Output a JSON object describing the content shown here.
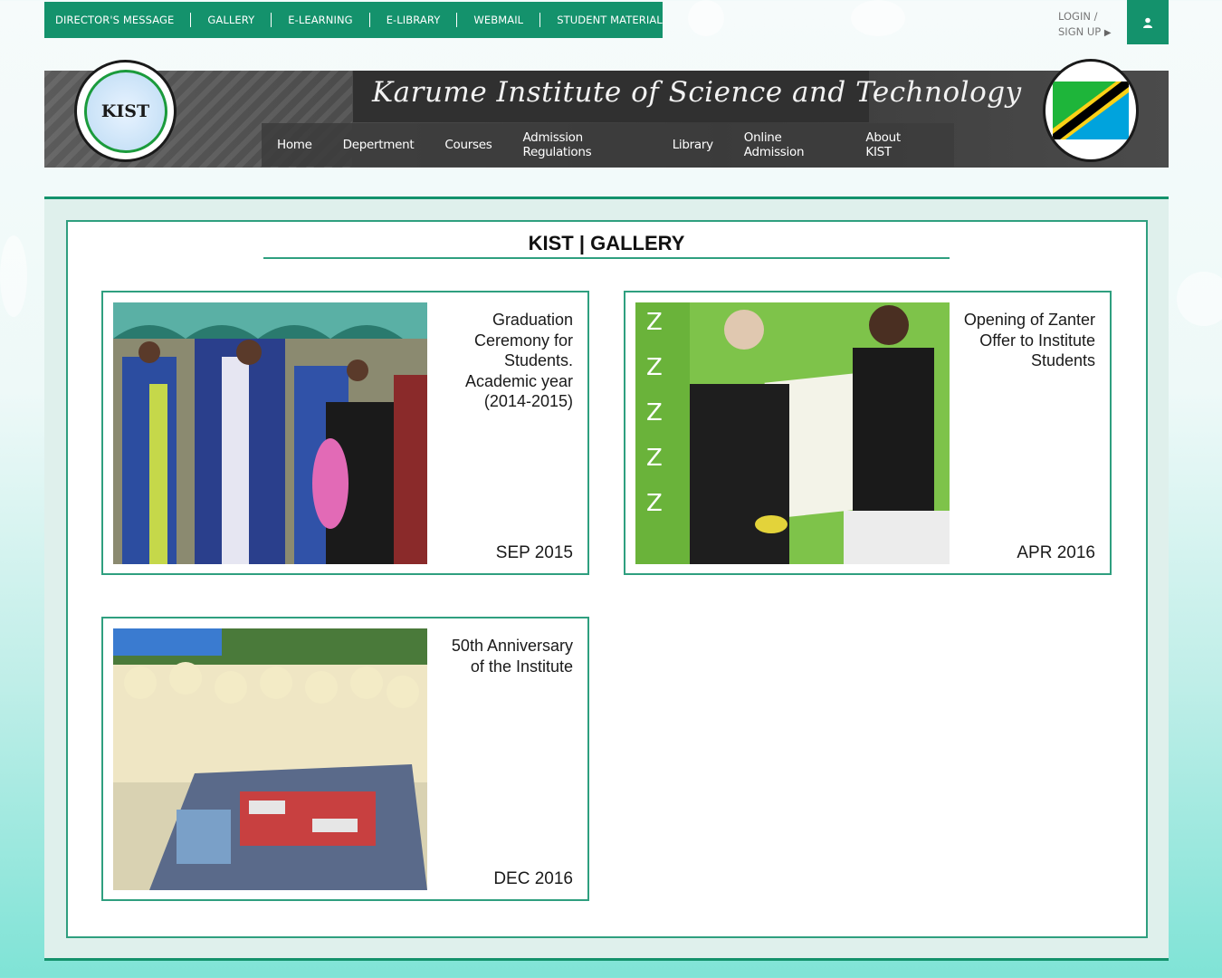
{
  "top_nav": {
    "items": [
      "DIRECTOR'S MESSAGE",
      "GALLERY",
      "E-LEARNING",
      "E-LIBRARY",
      "WEBMAIL",
      "STUDENT MATERIAL"
    ]
  },
  "account": {
    "login_label": "LOGIN /",
    "signup_label": "SIGN UP",
    "user_icon": "user-icon"
  },
  "banner": {
    "site_title": "Karume Institute of Science and Technology",
    "logo_text": "KIST",
    "flag_icon": "tanzania-flag-icon"
  },
  "main_nav": {
    "items": [
      "Home",
      "Depertment",
      "Courses",
      "Admission Regulations",
      "Library",
      "Online Admission",
      "About KIST"
    ]
  },
  "gallery": {
    "heading": "KIST | GALLERY",
    "cards": [
      {
        "caption": "Graduation Ceremony for Students. Academic year (2014-2015)",
        "date": "SEP 2015"
      },
      {
        "caption": "Opening of Zanter Offer to Institute Students",
        "date": "APR 2016"
      },
      {
        "caption": "50th Anniversary of the Institute",
        "date": "DEC 2016"
      }
    ]
  },
  "colors": {
    "accent": "#14926c",
    "border": "#2f9f7f",
    "content_bg": "#dff0ec"
  }
}
